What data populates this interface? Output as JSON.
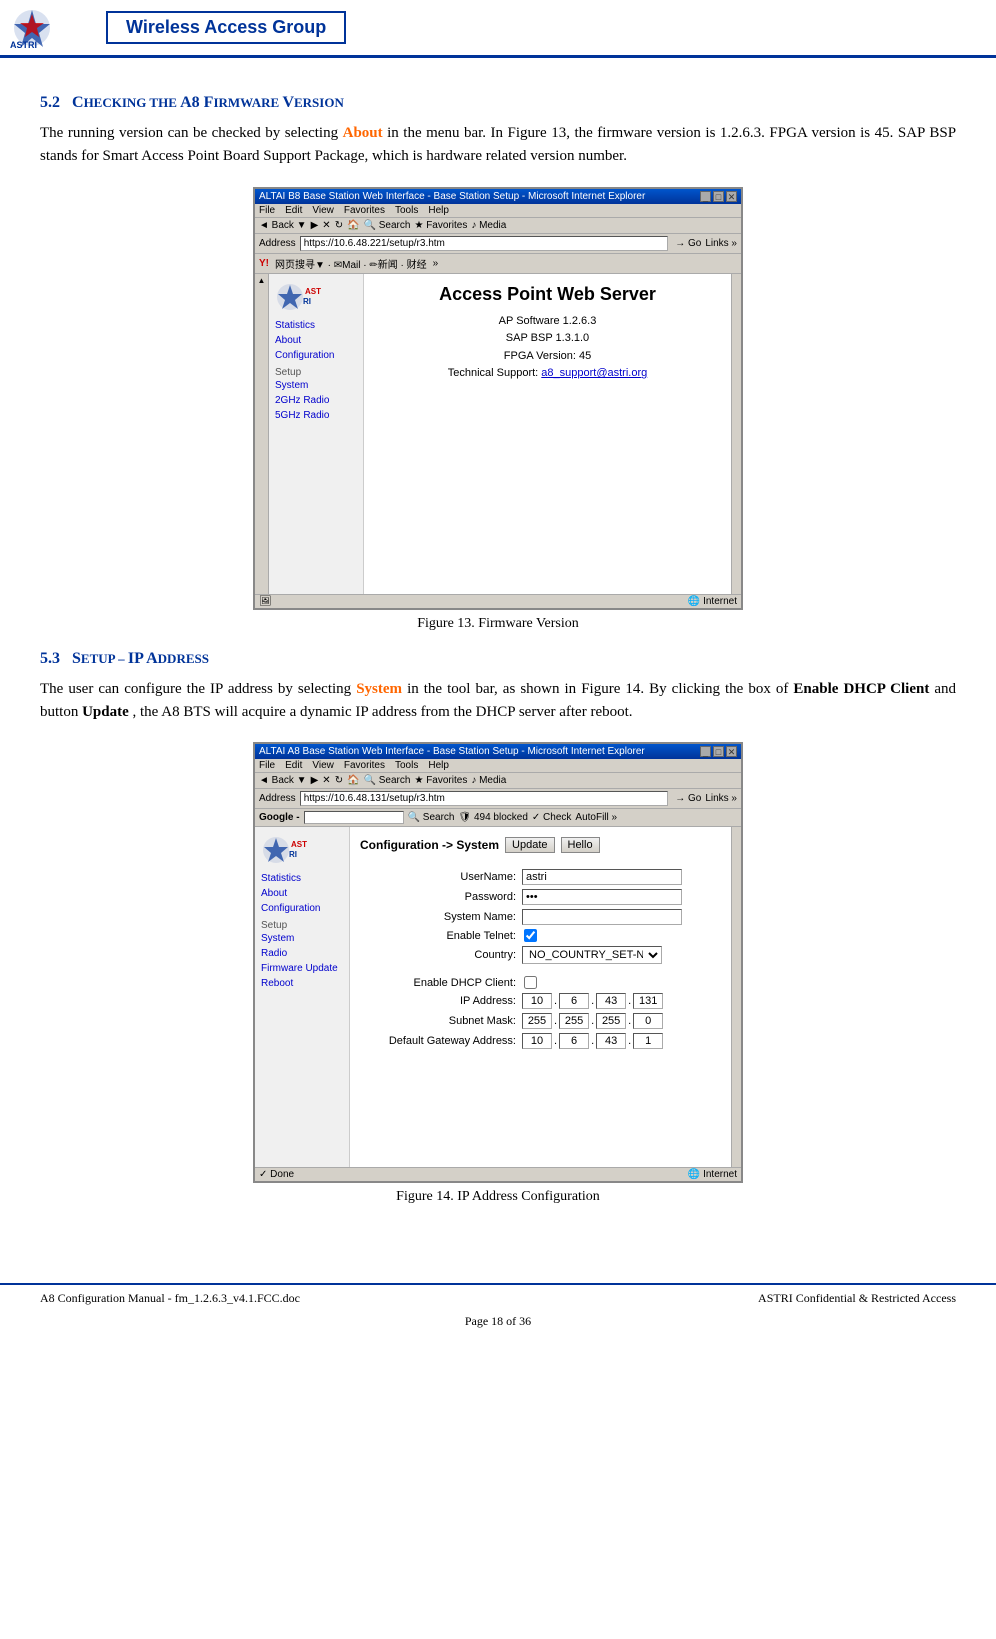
{
  "header": {
    "title": "Wireless Access Group",
    "logo_alt": "ASTRI Logo"
  },
  "section52": {
    "number": "5.2",
    "title": "Checking the A8 Firmware Version",
    "body1": "The running version can be checked by selecting",
    "highlight1": "About",
    "body2": "in the menu bar. In Figure 13, the firmware version is 1.2.6.3. FPGA version is 45. SAP BSP stands for Smart Access Point Board Support Package, which is hardware related version number.",
    "figure13": {
      "caption": "Figure 13. Firmware Version",
      "browser_title": "ALTAI B8 Base Station Web Interface - Base Station Setup - Microsoft Internet Explorer",
      "address": "https://10.6.48.221/setup/r3.htm",
      "menu": [
        "File",
        "Edit",
        "View",
        "Favorites",
        "Tools",
        "Help"
      ],
      "ap_title": "Access Point Web Server",
      "ap_info_lines": [
        "AP Software 1.2.6.3",
        "SAP BSP 1.3.1.0",
        "FPGA Version: 45",
        "Technical Support: a8_support@astri.org"
      ],
      "sidebar_items": [
        "Statistics",
        "About",
        "Configuration"
      ],
      "sidebar_setup": "Setup",
      "sidebar_setup_items": [
        "System",
        "2GHz Radio",
        "5GHz Radio"
      ]
    }
  },
  "section53": {
    "number": "5.3",
    "title": "Setup – IP Address",
    "body1": "The user can configure the IP address by selecting",
    "highlight1": "System",
    "body2": "in the tool bar, as shown in Figure 14. By clicking the box of",
    "bold1": "Enable DHCP Client",
    "body3": "and button",
    "bold2": "Update",
    "body4": ", the A8 BTS will acquire a dynamic IP address from the DHCP server after reboot.",
    "figure14": {
      "caption": "Figure 14. IP Address Configuration",
      "browser_title": "ALTAI A8 Base Station Web Interface - Base Station Setup - Microsoft Internet Explorer",
      "address": "https://10.6.48.131/setup/r3.htm",
      "menu": [
        "File",
        "Edit",
        "View",
        "Favorites",
        "Tools",
        "Help"
      ],
      "config_header": "Configuration -> System",
      "update_btn": "Update",
      "help_btn": "Hello",
      "fields": {
        "username_label": "UserName:",
        "username_value": "astri",
        "password_label": "Password:",
        "password_value": "***",
        "systemname_label": "System Name:",
        "systemname_value": "",
        "telnet_label": "Enable Telnet:",
        "telnet_checked": true,
        "country_label": "Country:",
        "country_value": "NO_COUNTRY_SET-NA",
        "dhcp_label": "Enable DHCP Client:",
        "dhcp_checked": false,
        "ip_label": "IP Address:",
        "ip_octets": [
          "10",
          "6",
          "43",
          "131"
        ],
        "subnet_label": "Subnet Mask:",
        "subnet_octets": [
          "255",
          "255",
          "255",
          "0"
        ],
        "gateway_label": "Default Gateway Address:",
        "gateway_octets": [
          "10",
          "6",
          "43",
          "1"
        ]
      },
      "sidebar_items": [
        "Statistics",
        "About",
        "Configuration"
      ],
      "sidebar_setup": "Setup",
      "sidebar_setup_items": [
        "System",
        "Radio",
        "Firmware Update",
        "Reboot"
      ]
    }
  },
  "footer": {
    "left": "A8 Configuration Manual - fm_1.2.6.3_v4.1.FCC.doc",
    "right": "ASTRI Confidential & Restricted Access",
    "page": "Page 18 of 36"
  }
}
